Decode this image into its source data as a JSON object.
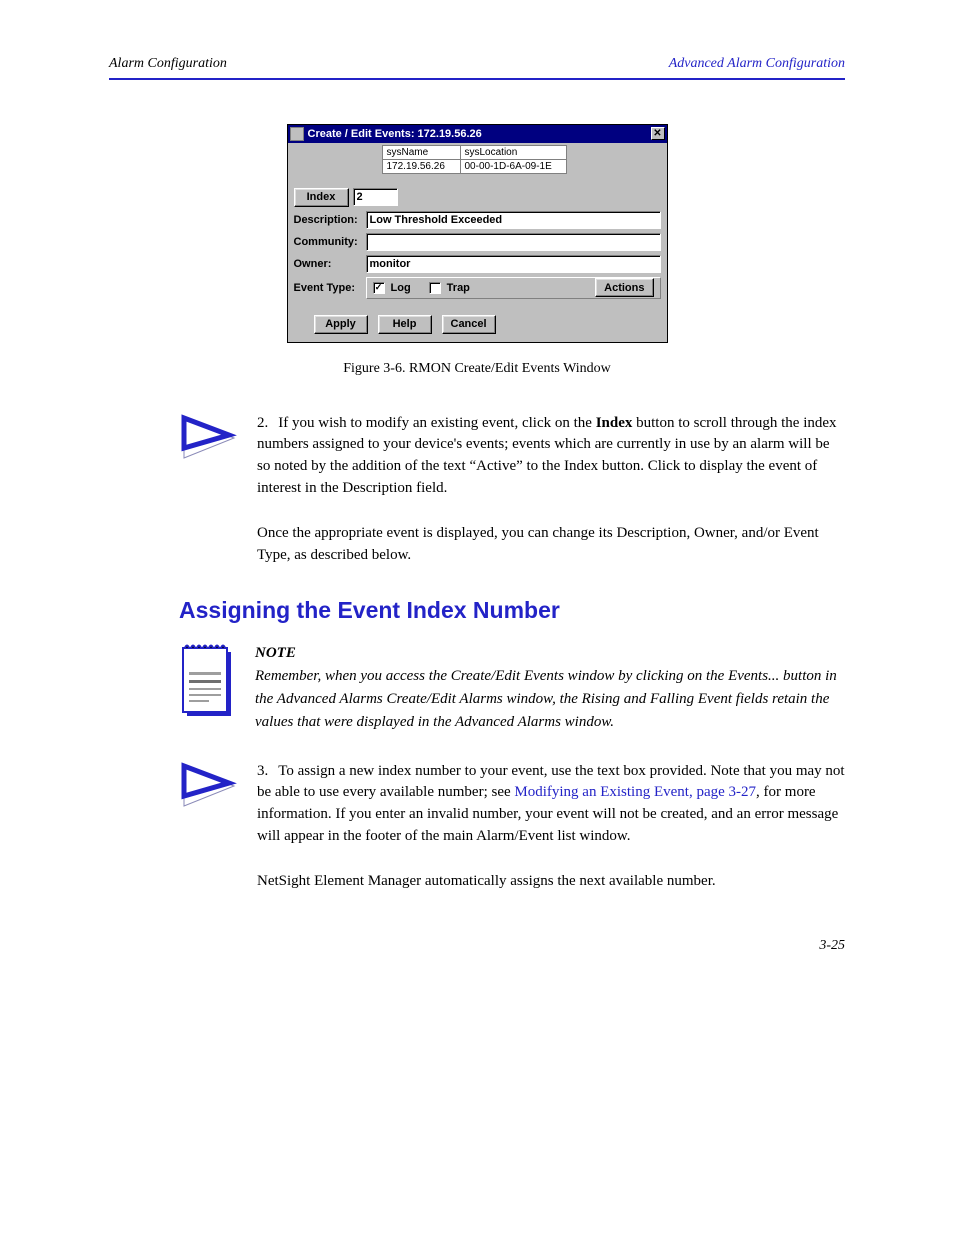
{
  "header": {
    "left": "Alarm Configuration",
    "right": "Advanced Alarm Configuration"
  },
  "dialog": {
    "title": "Create / Edit Events: 172.19.56.26",
    "close_glyph": "✕",
    "sys": {
      "name_label": "sysName",
      "name_value": "172.19.56.26",
      "loc_label": "sysLocation",
      "loc_value": "00-00-1D-6A-09-1E"
    },
    "index_btn": "Index",
    "index_val": "2",
    "desc_label": "Description:",
    "desc_val": "Low Threshold Exceeded",
    "comm_label": "Community:",
    "comm_val": "",
    "owner_label": "Owner:",
    "owner_val": "monitor",
    "et_label": "Event Type:",
    "log_label": "Log",
    "trap_label": "Trap",
    "actions_btn": "Actions",
    "apply_btn": "Apply",
    "help_btn": "Help",
    "cancel_btn": "Cancel"
  },
  "figure_caption": "Figure 3-6. RMON Create/Edit Events Window",
  "step2": {
    "num": "2.",
    "text_a": "If you wish to modify an existing event, click on the ",
    "bold_a": "Index",
    "text_b": " button to scroll through the index numbers assigned to your device's events; events which are currently in use by an alarm will be so noted by the addition of the text “Active” to the Index button. Click to display the event of interest in the Description field."
  },
  "para_after_step2": "Once the appropriate event is displayed, you can change its Description, Owner, and/or Event Type, as described below.",
  "h2": "Assigning the Event Index Number",
  "note": "Remember, when you access the Create/Edit Events window by clicking on the Events... button in the Advanced Alarms Create/Edit Alarms window, the Rising and Falling Event fields retain the values that were displayed in the Advanced Alarms window.",
  "step3": {
    "num": "3.",
    "text_a": "To assign a new index number to your event, use the text box provided. Note that you may not be able to use every available number; see ",
    "link": "Modifying an Existing Event, page 3-27",
    "text_b": ", for more information. If you enter an invalid number, your event will not be created, and an error message will appear in the footer of the main Alarm/Event list window."
  },
  "para_final": "NetSight Element Manager automatically assigns the next available number.",
  "footer": {
    "left": "",
    "right": "3-25"
  }
}
